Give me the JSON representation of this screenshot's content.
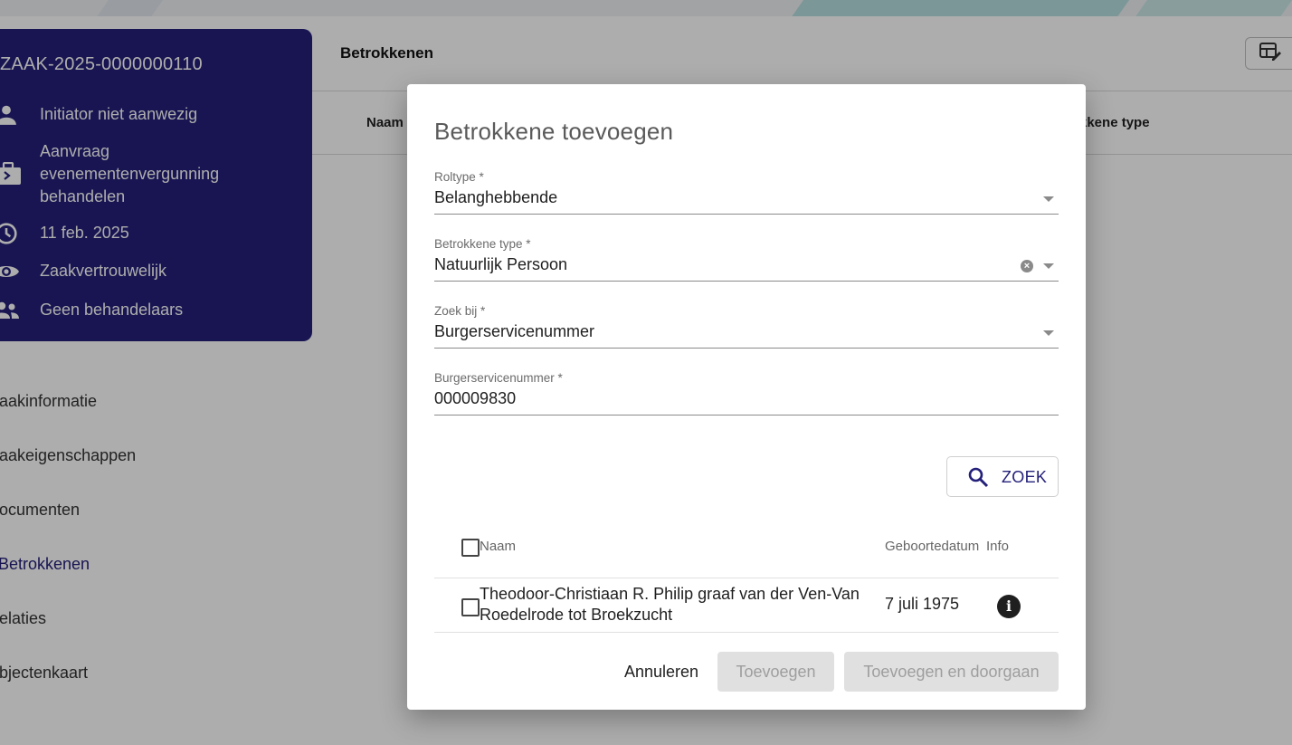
{
  "case": {
    "id": "ZAAK-2025-0000000110",
    "rows": [
      {
        "icon": "person-icon",
        "text": "Initiator niet aanwezig"
      },
      {
        "icon": "briefcase-icon",
        "lines": [
          "Aanvraag",
          "evenementenvergunning",
          "behandelen"
        ]
      },
      {
        "icon": "clock-icon",
        "text": "11 feb. 2025"
      },
      {
        "icon": "eye-icon",
        "text": "Zaakvertrouwelijk"
      },
      {
        "icon": "people-icon",
        "text": "Geen behandelaars"
      }
    ]
  },
  "sidebar": {
    "items": [
      {
        "label": "aakinformatie",
        "active": false
      },
      {
        "label": "aakeigenschappen",
        "active": false
      },
      {
        "label": "ocumenten",
        "active": false
      },
      {
        "label": "Betrokkenen",
        "active": true
      },
      {
        "label": "elaties",
        "active": false
      },
      {
        "label": "bjectenkaart",
        "active": false
      }
    ]
  },
  "main": {
    "title": "Betrokkenen",
    "columns": {
      "naam": "Naam",
      "type": "kkene type"
    }
  },
  "dialog": {
    "title": "Betrokkene toevoegen",
    "fields": {
      "roltype": {
        "label": "Roltype *",
        "value": "Belanghebbende"
      },
      "betrokkene_type": {
        "label": "Betrokkene type *",
        "value": "Natuurlijk Persoon"
      },
      "zoek_bij": {
        "label": "Zoek bij *",
        "value": "Burgerservicenummer"
      },
      "bsn": {
        "label": "Burgerservicenummer *",
        "value": "000009830"
      }
    },
    "search_label": "ZOEK",
    "results": {
      "headers": {
        "naam": "Naam",
        "geboortedatum": "Geboortedatum",
        "info": "Info"
      },
      "rows": [
        {
          "naam": "Theodoor-Christiaan R. Philip graaf van der Ven-Van Roedelrode tot Broekzucht",
          "geboortedatum": "7 juli 1975"
        }
      ]
    },
    "buttons": {
      "cancel": "Annuleren",
      "add": "Toevoegen",
      "add_continue": "Toevoegen en doorgaan"
    }
  },
  "colors": {
    "brand": "#24207a",
    "overlay": "rgba(0,0,0,0.32)"
  }
}
